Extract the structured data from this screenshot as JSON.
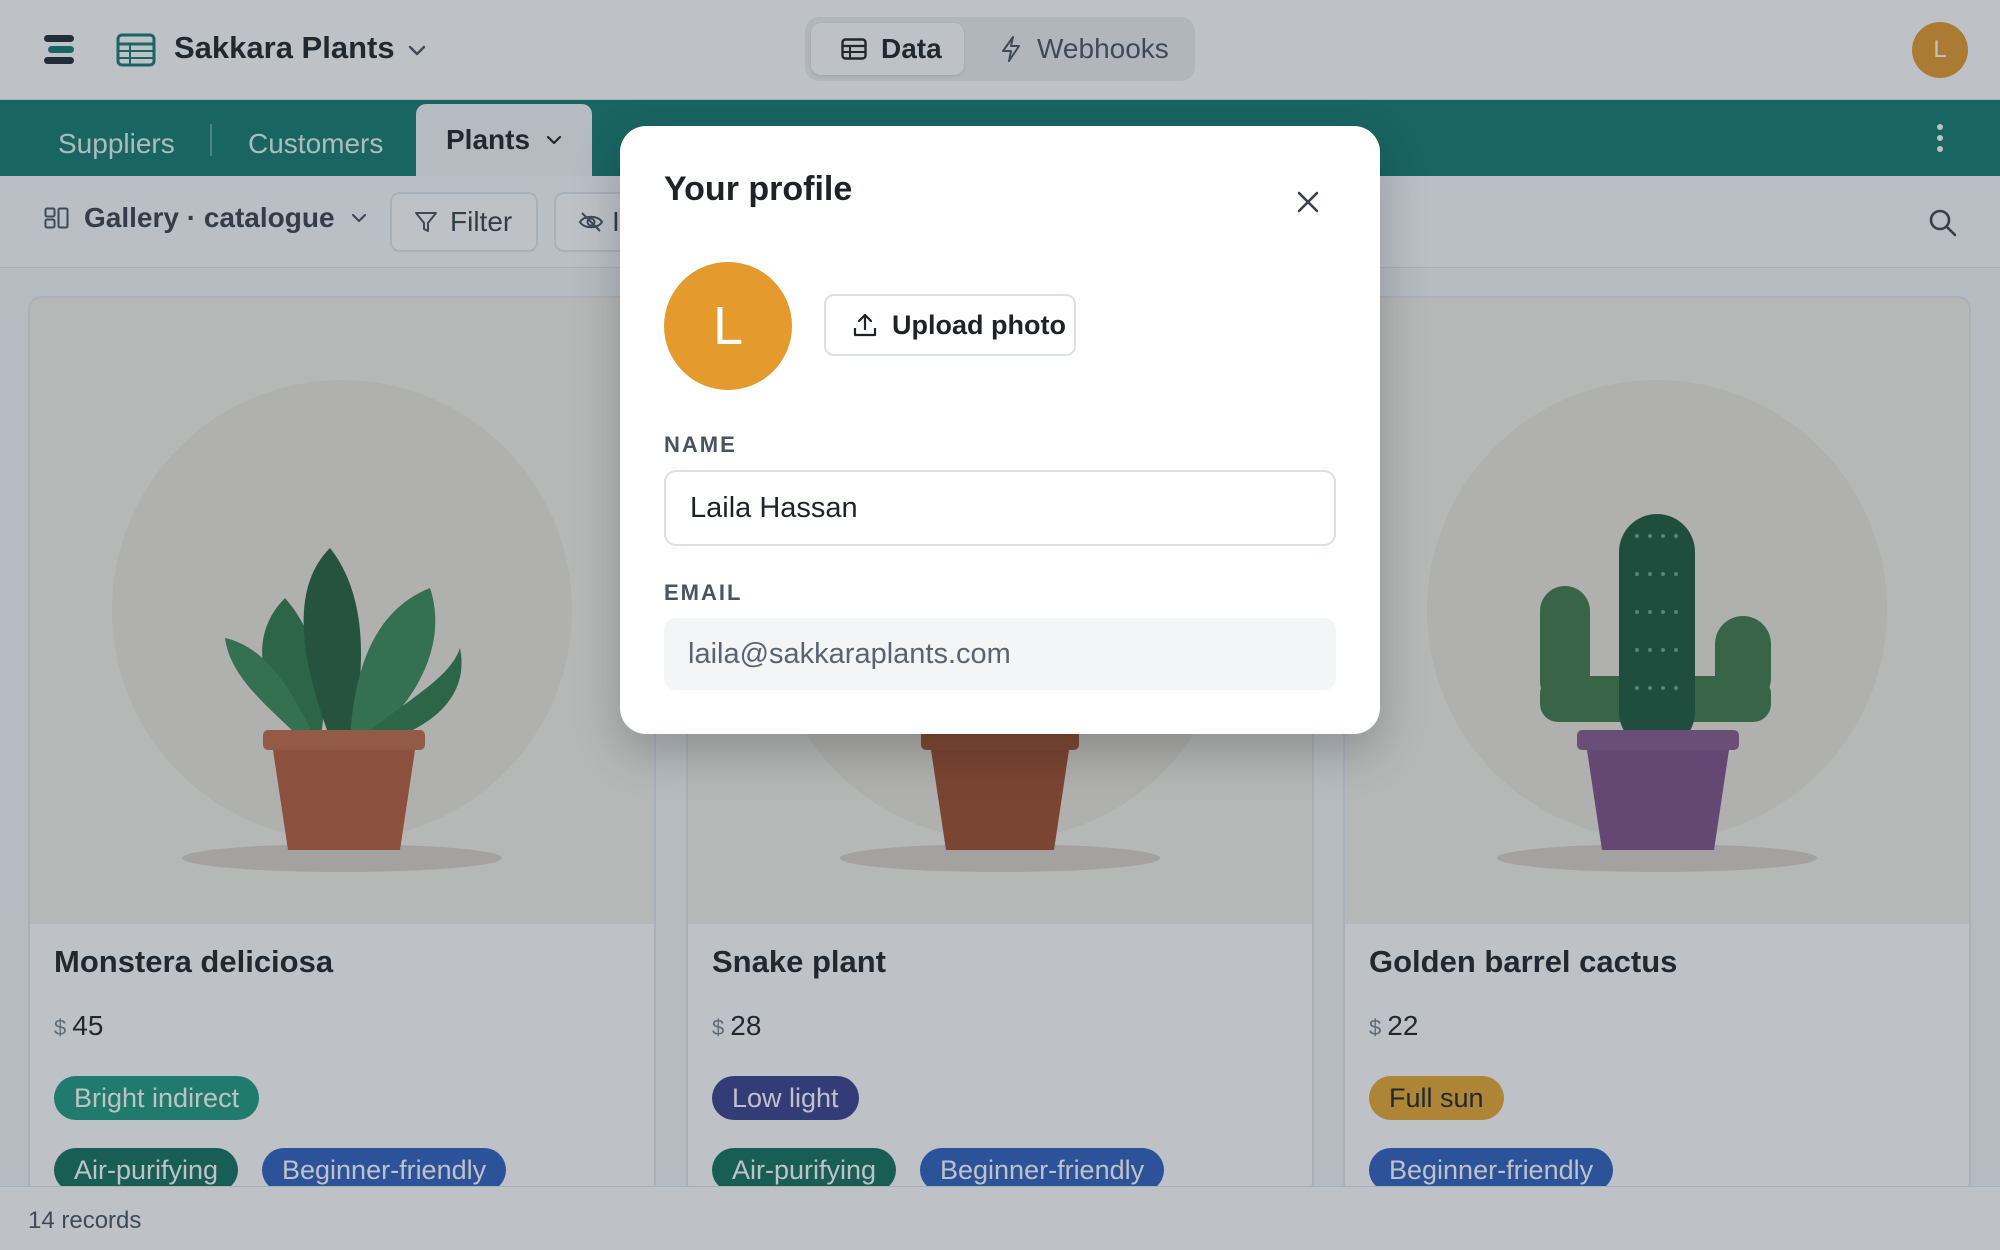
{
  "app": {
    "base_title": "Sakkara Plants",
    "user_initial": "L"
  },
  "header": {
    "modes": [
      {
        "label": "Data",
        "icon": "table-icon",
        "active": true
      },
      {
        "label": "Webhooks",
        "icon": "lightning-icon",
        "active": false
      }
    ]
  },
  "tables": [
    {
      "label": "Suppliers",
      "active": false
    },
    {
      "label": "Customers",
      "active": false
    },
    {
      "label": "Plants",
      "active": true
    }
  ],
  "toolbar": {
    "view_label": "Gallery · catalogue",
    "filter_label": "Filter",
    "hide_fields_visible_text": "I"
  },
  "gallery": {
    "cards": [
      {
        "title": "Monstera deliciosa",
        "currency": "$",
        "price": "45",
        "light": {
          "label": "Bright indirect",
          "color": "#1f9a7f"
        },
        "tags": [
          {
            "label": "Air-purifying",
            "color": "#13705c"
          },
          {
            "label": "Beginner-friendly",
            "color": "#2f5fbf"
          }
        ]
      },
      {
        "title": "Snake plant",
        "currency": "$",
        "price": "28",
        "light": {
          "label": "Low light",
          "color": "#3a3f8f"
        },
        "tags": [
          {
            "label": "Air-purifying",
            "color": "#13705c"
          },
          {
            "label": "Beginner-friendly",
            "color": "#2f5fbf"
          }
        ]
      },
      {
        "title": "Golden barrel cactus",
        "currency": "$",
        "price": "22",
        "light": {
          "label": "Full sun",
          "color": "#e9a730",
          "text_color": "#1f2328"
        },
        "tags": [
          {
            "label": "Beginner-friendly",
            "color": "#2f5fbf"
          }
        ]
      }
    ]
  },
  "footer": {
    "record_count": "14 records"
  },
  "profile_modal": {
    "title": "Your profile",
    "avatar_initial": "L",
    "upload_label": "Upload photo",
    "name_label": "NAME",
    "name_value": "Laila Hassan",
    "email_label": "EMAIL",
    "email_value": "laila@sakkaraplants.com"
  },
  "colors": {
    "brand": "#137a6f",
    "avatar": "#e49a2d"
  }
}
